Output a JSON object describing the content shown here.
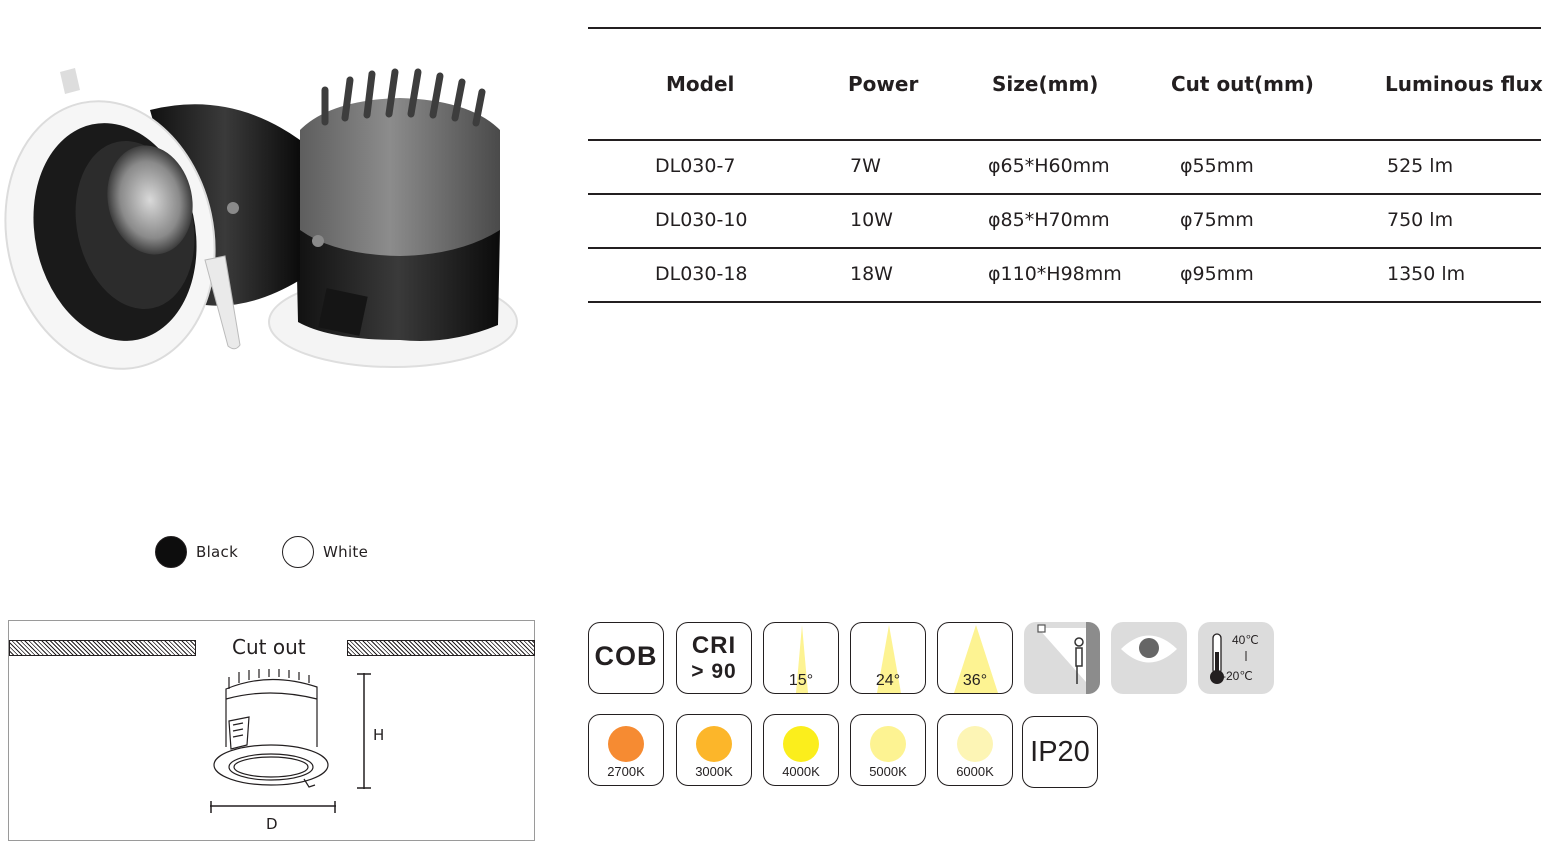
{
  "table": {
    "headers": [
      "Model",
      "Power",
      "Size(mm)",
      "Cut out(mm)",
      "Luminous flux"
    ],
    "rows": [
      [
        "DL030-7",
        "7W",
        "φ65*H60mm",
        "φ55mm",
        "525 lm"
      ],
      [
        "DL030-10",
        "10W",
        "φ85*H70mm",
        "φ75mm",
        "750 lm"
      ],
      [
        "DL030-18",
        "18W",
        "φ110*H98mm",
        "φ95mm",
        "1350 lm"
      ]
    ]
  },
  "colors": [
    {
      "label": "Black",
      "hex": "#0d0d0d"
    },
    {
      "label": "White",
      "hex": "#ffffff"
    }
  ],
  "drawing": {
    "cut_label": "Cut out",
    "height_label": "H",
    "diameter_label": "D"
  },
  "features": {
    "cob": "COB",
    "cri_line1": "CRI",
    "cri_line2": "> 90",
    "beams": [
      "15°",
      "24°",
      "36°"
    ],
    "wall_icon": "wall-wash-icon",
    "eye_icon": "eye-icon",
    "temp_high": "40℃",
    "temp_low": "-20℃",
    "ip": "IP20"
  },
  "cct": [
    {
      "label": "2700K",
      "hex": "#f68b32"
    },
    {
      "label": "3000K",
      "hex": "#fcb62a"
    },
    {
      "label": "4000K",
      "hex": "#fbee1c"
    },
    {
      "label": "5000K",
      "hex": "#fdf392"
    },
    {
      "label": "6000K",
      "hex": "#fdf5b5"
    }
  ]
}
